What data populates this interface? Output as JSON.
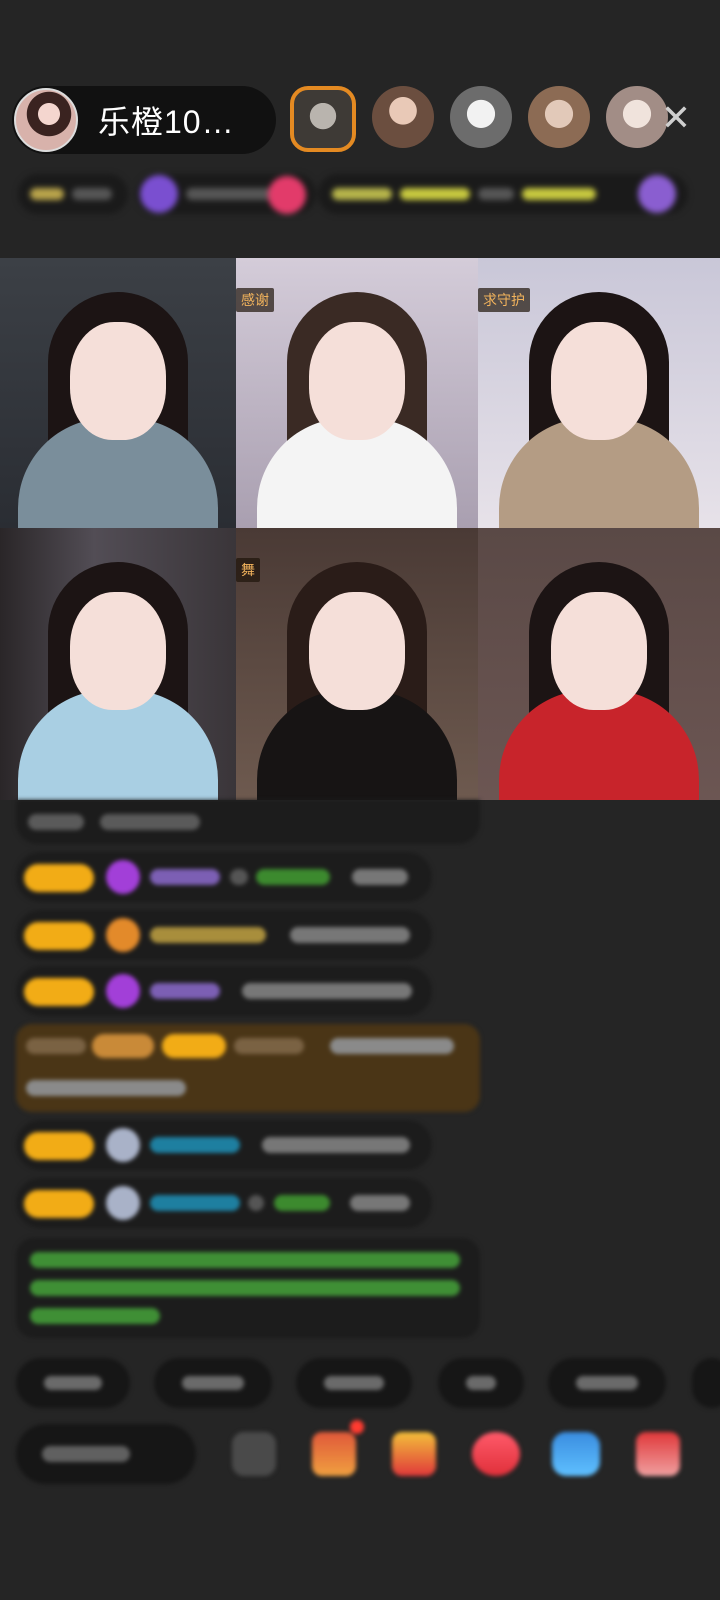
{
  "header": {
    "host_name": "乐橙10…",
    "close_icon": "close-icon"
  },
  "viewer_avatars": [
    "rank-1",
    "viewer-2",
    "viewer-3",
    "viewer-4",
    "viewer-5"
  ],
  "video_tiles": [
    {
      "tag": ""
    },
    {
      "tag": "感谢"
    },
    {
      "tag": "求守护"
    },
    {
      "tag": ""
    },
    {
      "tag": "舞"
    },
    {
      "tag": ""
    }
  ],
  "colors": {
    "badge": "#f2ac16",
    "gift_purple": "#a23fd8",
    "user_green": "#4fbf3a",
    "user_cyan": "#25a9d6",
    "system_green": "#58c548",
    "highlight_bg": "#4a3516"
  }
}
